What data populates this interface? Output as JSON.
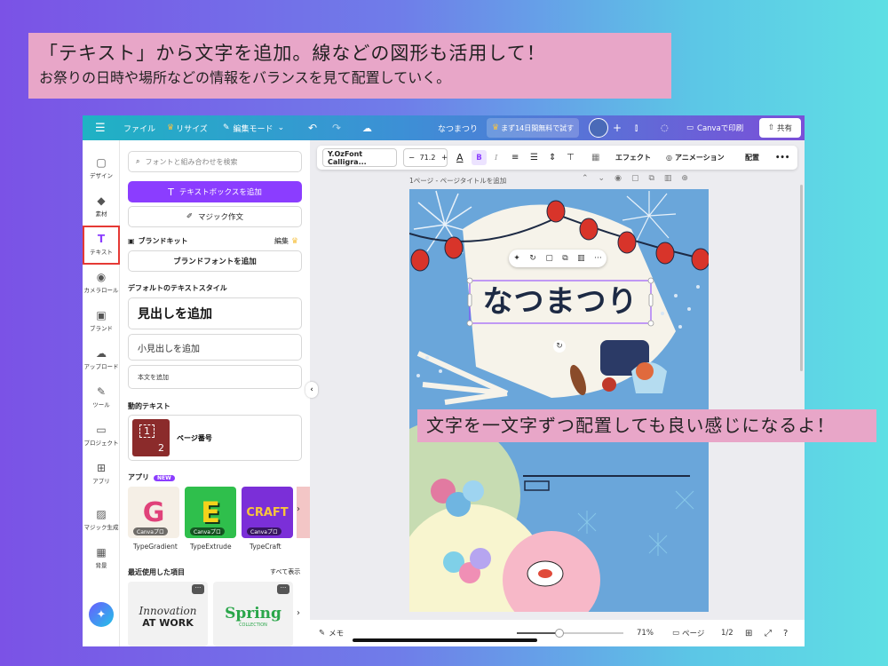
{
  "notes": {
    "top_line1": "「テキスト」から文字を追加。線などの図形も活用して！",
    "top_line2": "お祭りの日時や場所などの情報をバランスを見て配置していく。",
    "middle": "文字を一文字ずつ配置しても良い感じになるよ！"
  },
  "topbar": {
    "menu_icon": "☰",
    "file": "ファイル",
    "resize": "リサイズ",
    "edit_mode": "編集モード",
    "doc_title": "なつまつり",
    "trial": "まず14日間無料で試す",
    "print": "Canvaで印刷",
    "share": "共有"
  },
  "rail": [
    {
      "icon": "▢",
      "label": "デザイン"
    },
    {
      "icon": "◆",
      "label": "素材"
    },
    {
      "icon": "T",
      "label": "テキスト"
    },
    {
      "icon": "◉",
      "label": "カメラロール"
    },
    {
      "icon": "▣",
      "label": "ブランド"
    },
    {
      "icon": "☁",
      "label": "アップロード"
    },
    {
      "icon": "✎",
      "label": "ツール"
    },
    {
      "icon": "▭",
      "label": "プロジェクト"
    },
    {
      "icon": "⊞",
      "label": "アプリ"
    },
    {
      "icon": "▨",
      "label": "マジック生成"
    },
    {
      "icon": "▦",
      "label": "背景"
    }
  ],
  "panel": {
    "search_placeholder": "フォントと組み合わせを検索",
    "add_textbox": "テキストボックスを追加",
    "magic_write": "マジック作文",
    "brand_kit": "ブランドキット",
    "brand_edit": "編集",
    "brand_fonts": "ブランドフォントを追加",
    "default_styles": "デフォルトのテキストスタイル",
    "heading": "見出しを追加",
    "subheading": "小見出しを追加",
    "body": "本文を追加",
    "dynamic_text": "動的テキスト",
    "page_number": "ページ番号",
    "apps": "アプリ",
    "apps_new": "NEW",
    "app_tiles": [
      {
        "name": "TypeGradient",
        "glyph": "G",
        "badge": "Canvaプロ"
      },
      {
        "name": "TypeExtrude",
        "glyph": "E",
        "badge": "Canvaプロ"
      },
      {
        "name": "TypeCraft",
        "glyph": "CRAFT",
        "badge": "Canvaプロ"
      }
    ],
    "recent": "最近使用した項目",
    "show_all": "すべて表示",
    "recent_tiles": [
      {
        "line1": "Innovation",
        "line2": "AT WORK"
      },
      {
        "line1": "Spring",
        "line2": "COLLECTION"
      }
    ]
  },
  "ctx": {
    "font": "Y.OzFont Calligra...",
    "minus": "−",
    "size": "71.2",
    "plus": "+",
    "effect": "エフェクト",
    "animation": "アニメーション",
    "arrange": "配置",
    "more": "•••"
  },
  "page_header": {
    "label": "1ページ - ページタイトルを追加"
  },
  "design": {
    "title": "なつまつり"
  },
  "bottom": {
    "notes": "メモ",
    "zoom": "71%",
    "pages": "ページ",
    "page_count": "1/2",
    "zoom_fraction": 0.4
  },
  "colors": {
    "accent": "#8b3dff",
    "highlight": "#e53935",
    "note_bg": "#e8a6c8"
  }
}
